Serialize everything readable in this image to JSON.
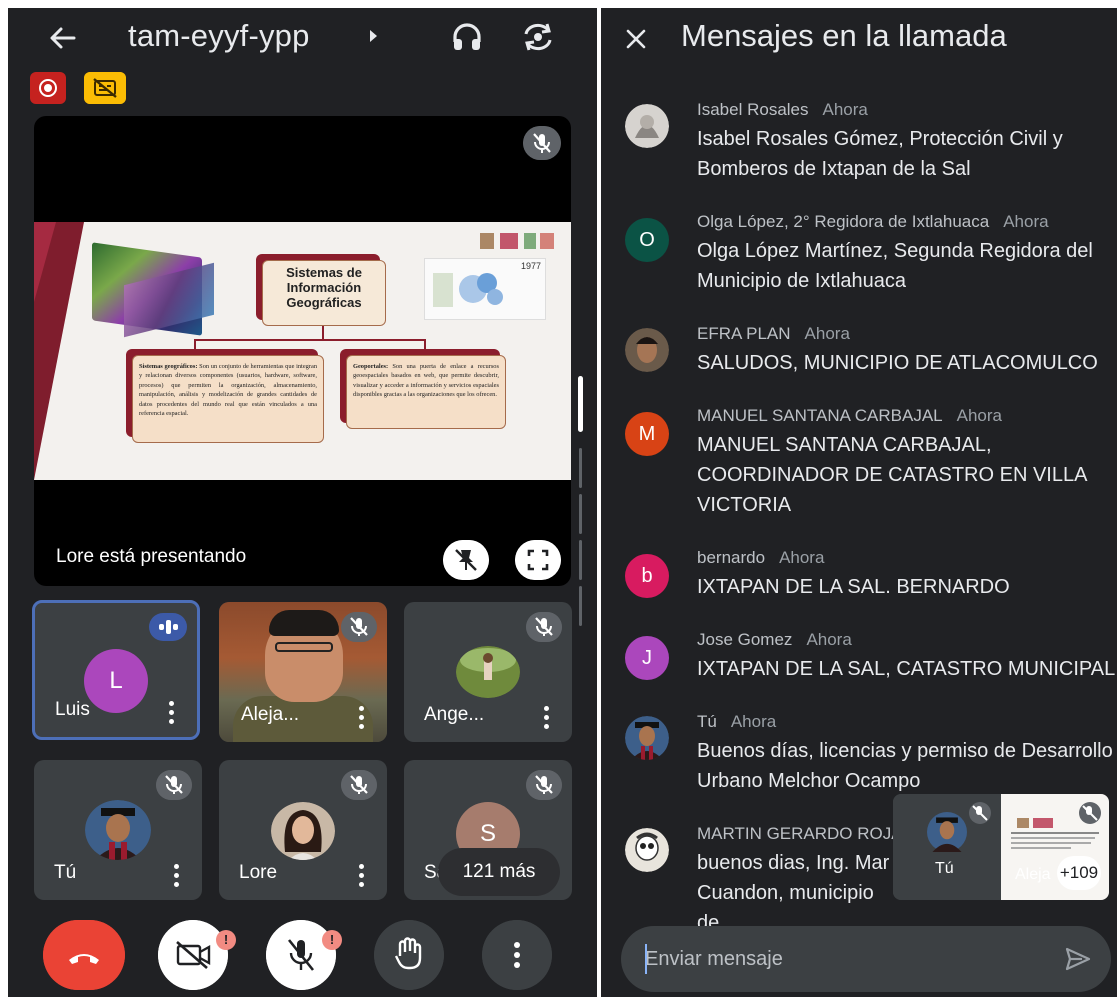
{
  "meeting": {
    "code": "tam-eyyf-ypp",
    "presenting_text": "Lore está presentando"
  },
  "slide": {
    "title": "Sistemas de Información Geográficas",
    "year": "1977",
    "box_left_title": "Sistemas geográficos:",
    "box_left_body": "Son un conjunto de herramientas que integran y relacionan diversos componentes (usuarios, hardware, software, procesos) que permiten la organización, almacenamiento, manipulación, análisis y modelización de grandes cantidades de datos procedentes del mundo real que están vinculados a una referencia espacial.",
    "box_right_title": "Geoportales:",
    "box_right_body": "Son una puerta de enlace a recursos geoespaciales basados en web, que permite descubrir, visualizar y acceder a información y servicios espaciales disponibles gracias a las organizaciones que los ofrecen."
  },
  "tiles": [
    {
      "name": "Luis",
      "initial": "L",
      "avatar_color": "#ab47bc"
    },
    {
      "name": "Aleja..."
    },
    {
      "name": "Ange..."
    },
    {
      "name": "Tú"
    },
    {
      "name": "Lore"
    },
    {
      "name": "San",
      "initial": "S",
      "avatar_color": "#a67c6d"
    }
  ],
  "more_participants": "121 más",
  "alert_badge": "!",
  "chat": {
    "title": "Mensajes en la llamada",
    "messages": [
      {
        "sender": "Isabel Rosales",
        "time": "Ahora",
        "text": "Isabel Rosales Gómez, Protección Civil y Bomberos de Ixtapan de la Sal"
      },
      {
        "sender": "Olga López, 2° Regidora de Ixtlahuaca",
        "time": "Ahora",
        "text": "Olga López Martínez, Segunda Regidora del Municipio de Ixtlahuaca",
        "initial": "O",
        "avatar_color": "#0b5345"
      },
      {
        "sender": "EFRA PLAN",
        "time": "Ahora",
        "text": "SALUDOS, MUNICIPIO DE ATLACOMULCO"
      },
      {
        "sender": "MANUEL SANTANA CARBAJAL",
        "time": "Ahora",
        "text": "MANUEL SANTANA CARBAJAL, COORDINADOR DE CATASTRO EN VILLA VICTORIA",
        "initial": "M",
        "avatar_color": "#d84315"
      },
      {
        "sender": "bernardo",
        "time": "Ahora",
        "text": "IXTAPAN DE LA SAL. BERNARDO",
        "initial": "b",
        "avatar_color": "#d81b60"
      },
      {
        "sender": "Jose Gomez",
        "time": "Ahora",
        "text": "IXTAPAN DE LA SAL, CATASTRO MUNICIPAL",
        "initial": "J",
        "avatar_color": "#ab47bc"
      },
      {
        "sender": "Tú",
        "time": "Ahora",
        "text": "Buenos días, licencias y permiso de Desarrollo Urbano Melchor Ocampo"
      },
      {
        "sender": "MARTIN GERARDO ROJA",
        "time": "",
        "text": "buenos dias, Ing. Mar Cuandon, municipio de"
      }
    ],
    "input_placeholder": "Enviar mensaje"
  },
  "pip": {
    "self_name": "Tú",
    "other_name": "Aleja",
    "count": "+109"
  }
}
